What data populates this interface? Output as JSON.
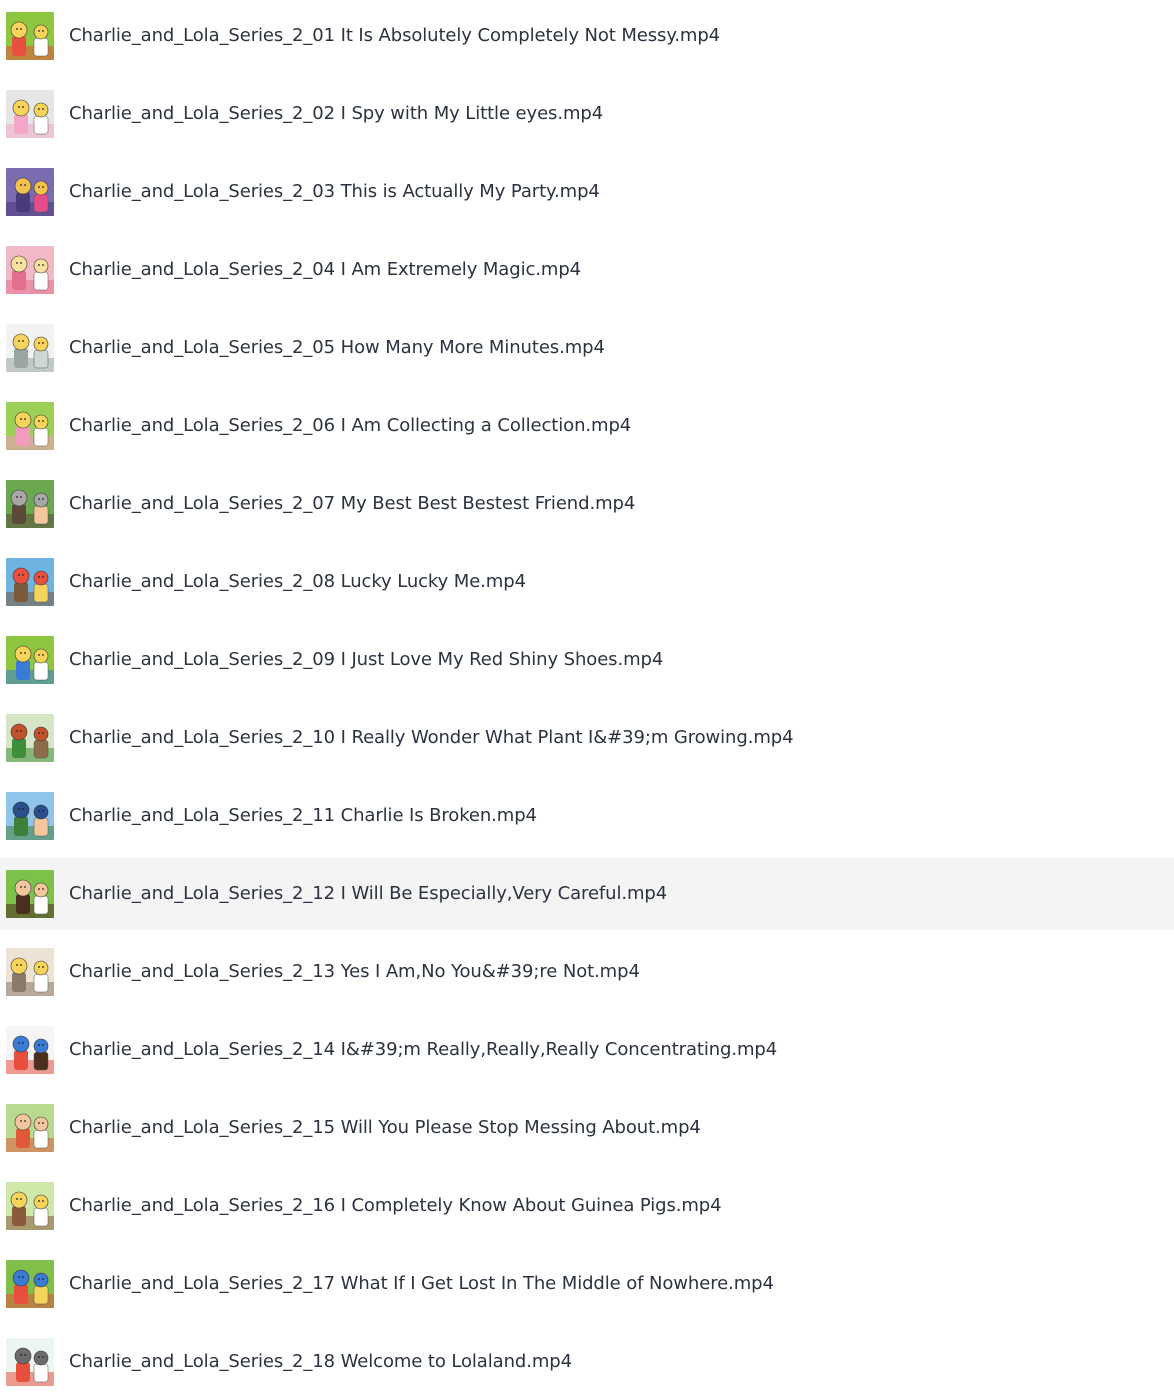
{
  "files": [
    {
      "name": "Charlie_and_Lola_Series_2_01 It Is Absolutely Completely Not Messy.mp4",
      "thumb": {
        "bg": "#8dc63f",
        "a": "#e94f3d",
        "b": "#f6d35b",
        "c": "#ffffff"
      }
    },
    {
      "name": "Charlie_and_Lola_Series_2_02 I Spy with My Little eyes.mp4",
      "thumb": {
        "bg": "#e6e6e6",
        "a": "#f3a6c8",
        "b": "#f6d35b",
        "c": "#ffffff"
      }
    },
    {
      "name": "Charlie_and_Lola_Series_2_03 This is Actually My Party.mp4",
      "thumb": {
        "bg": "#7b6bb0",
        "a": "#4a3b7a",
        "b": "#f2c14e",
        "c": "#e84b8a"
      }
    },
    {
      "name": "Charlie_and_Lola_Series_2_04 I Am Extremely Magic.mp4",
      "thumb": {
        "bg": "#f3b8c6",
        "a": "#e46f8c",
        "b": "#f7e1a0",
        "c": "#ffffff"
      }
    },
    {
      "name": "Charlie_and_Lola_Series_2_05 How Many More Minutes.mp4",
      "thumb": {
        "bg": "#f2f2f2",
        "a": "#9aa7a0",
        "b": "#f6d35b",
        "c": "#cfd8d2"
      }
    },
    {
      "name": "Charlie_and_Lola_Series_2_06 I Am Collecting a Collection.mp4",
      "thumb": {
        "bg": "#9ccf56",
        "a": "#f49ac1",
        "b": "#f6d35b",
        "c": "#ffffff"
      }
    },
    {
      "name": "Charlie_and_Lola_Series_2_07 My Best Best Bestest Friend.mp4",
      "thumb": {
        "bg": "#6aa84f",
        "a": "#5b4a3a",
        "b": "#a7a7a7",
        "c": "#f3c79b"
      }
    },
    {
      "name": "Charlie_and_Lola_Series_2_08 Lucky Lucky Me.mp4",
      "thumb": {
        "bg": "#6fb3e0",
        "a": "#7a5a3a",
        "b": "#e94f3d",
        "c": "#f6d35b"
      }
    },
    {
      "name": "Charlie_and_Lola_Series_2_09 I Just Love My Red Shiny Shoes.mp4",
      "thumb": {
        "bg": "#8dc63f",
        "a": "#3a7bd5",
        "b": "#f6d35b",
        "c": "#ffffff"
      }
    },
    {
      "name": "Charlie_and_Lola_Series_2_10 I Really Wonder What Plant I&#39;m Growing.mp4",
      "thumb": {
        "bg": "#d8e6c8",
        "a": "#3f8f3a",
        "b": "#c0522d",
        "c": "#8e6b4a"
      }
    },
    {
      "name": "Charlie_and_Lola_Series_2_11 Charlie Is Broken.mp4",
      "thumb": {
        "bg": "#8ec5e8",
        "a": "#3f7f3a",
        "b": "#2a4f8a",
        "c": "#f3c79b"
      }
    },
    {
      "name": "Charlie_and_Lola_Series_2_12 I Will Be Especially,Very Careful.mp4",
      "thumb": {
        "bg": "#7cc24a",
        "a": "#4a2e1e",
        "b": "#f3c79b",
        "c": "#ffffff"
      }
    },
    {
      "name": "Charlie_and_Lola_Series_2_13 Yes I Am,No You&#39;re Not.mp4",
      "thumb": {
        "bg": "#ece3d4",
        "a": "#8a7a6a",
        "b": "#f6d35b",
        "c": "#ffffff"
      }
    },
    {
      "name": "Charlie_and_Lola_Series_2_14 I&#39;m Really,Really,Really Concentrating.mp4",
      "thumb": {
        "bg": "#f5f5f5",
        "a": "#e94f3d",
        "b": "#3a7bd5",
        "c": "#4a2e1e"
      }
    },
    {
      "name": "Charlie_and_Lola_Series_2_15 Will You Please Stop Messing About.mp4",
      "thumb": {
        "bg": "#b9d98e",
        "a": "#e05a3a",
        "b": "#f3c79b",
        "c": "#ffffff"
      }
    },
    {
      "name": "Charlie_and_Lola_Series_2_16 I Completely Know About Guinea Pigs.mp4",
      "thumb": {
        "bg": "#cde8a8",
        "a": "#8a5a3a",
        "b": "#f6d35b",
        "c": "#ffffff"
      }
    },
    {
      "name": "Charlie_and_Lola_Series_2_17 What If I Get Lost In The Middle of Nowhere.mp4",
      "thumb": {
        "bg": "#7fbf4a",
        "a": "#e94f3d",
        "b": "#3a7bd5",
        "c": "#f6d35b"
      }
    },
    {
      "name": "Charlie_and_Lola_Series_2_18 Welcome to Lolaland.mp4",
      "thumb": {
        "bg": "#eef6f4",
        "a": "#e94f3d",
        "b": "#6b6b6b",
        "c": "#ffffff"
      }
    }
  ],
  "highlighted_index": 11,
  "colors": {
    "text": "#2b3240",
    "row_highlight": "#f4f4f5",
    "background": "#ffffff"
  }
}
